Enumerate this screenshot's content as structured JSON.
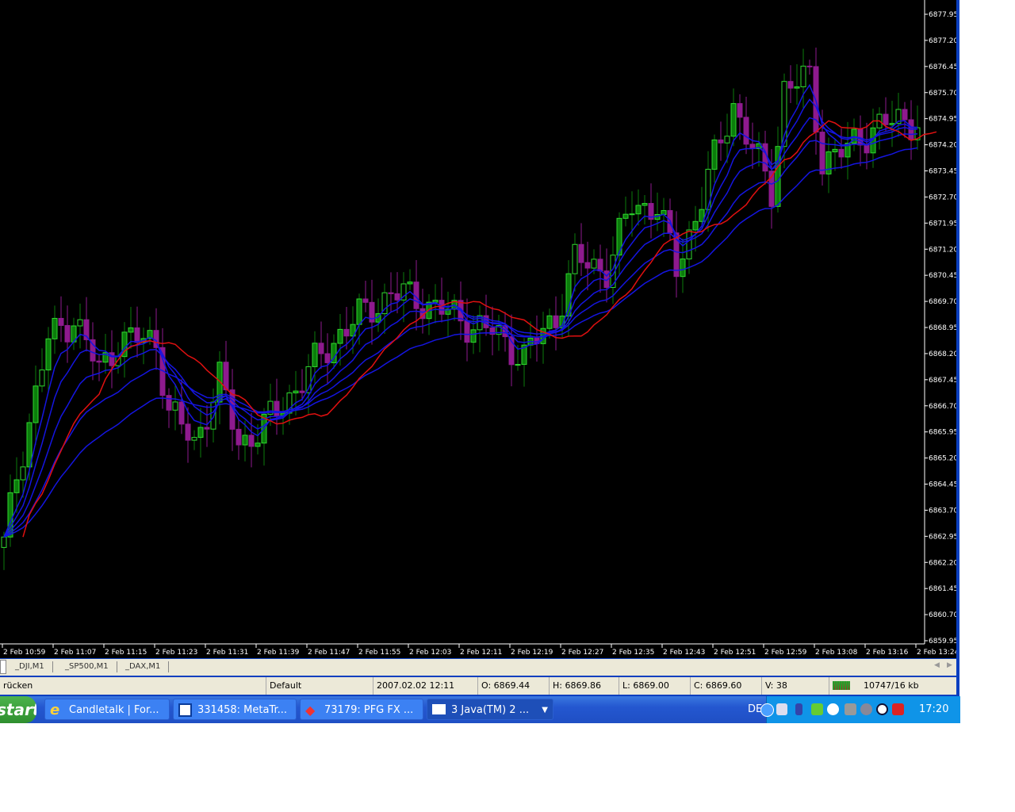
{
  "chart_data": {
    "type": "candlestick",
    "symbol": "_DAX,M1",
    "price_ticks": [
      "6877.95",
      "6877.20",
      "6876.45",
      "6875.70",
      "6874.95",
      "6874.20",
      "6873.45",
      "6872.70",
      "6871.95",
      "6871.20",
      "6870.45",
      "6869.70",
      "6868.95",
      "6868.20",
      "6867.45",
      "6866.70",
      "6865.95",
      "6865.20",
      "6864.45",
      "6863.70",
      "6862.95",
      "6862.20",
      "6861.45",
      "6860.70",
      "6859.95"
    ],
    "ylim": [
      6859.95,
      6877.95
    ],
    "time_ticks": [
      "2 Feb 10:59",
      "2 Feb 11:07",
      "2 Feb 11:15",
      "2 Feb 11:23",
      "2 Feb 11:31",
      "2 Feb 11:39",
      "2 Feb 11:47",
      "2 Feb 11:55",
      "2 Feb 12:03",
      "2 Feb 12:11",
      "2 Feb 12:19",
      "2 Feb 12:27",
      "2 Feb 12:35",
      "2 Feb 12:43",
      "2 Feb 12:51",
      "2 Feb 12:59",
      "2 Feb 13:08",
      "2 Feb 13:16",
      "2 Feb 13:24"
    ],
    "bar_count": 145,
    "price_path": [
      [
        0,
        6862.68
      ],
      [
        2,
        6864.72
      ],
      [
        7,
        6868.59
      ],
      [
        11,
        6869.27
      ],
      [
        15,
        6867.68
      ],
      [
        18,
        6868.59
      ],
      [
        24,
        6868.59
      ],
      [
        26,
        6866.54
      ],
      [
        30,
        6865.63
      ],
      [
        34,
        6867.45
      ],
      [
        37,
        6865.63
      ],
      [
        41,
        6866.09
      ],
      [
        46,
        6867.22
      ],
      [
        53,
        6868.81
      ],
      [
        61,
        6869.95
      ],
      [
        66,
        6869.72
      ],
      [
        71,
        6869.27
      ],
      [
        77,
        6868.81
      ],
      [
        82,
        6868.13
      ],
      [
        87,
        6869.27
      ],
      [
        90,
        6870.86
      ],
      [
        95,
        6870.63
      ],
      [
        99,
        6872.45
      ],
      [
        103,
        6872.45
      ],
      [
        106,
        6870.63
      ],
      [
        110,
        6872.68
      ],
      [
        115,
        6875.4
      ],
      [
        118,
        6874.04
      ],
      [
        121,
        6872.9
      ],
      [
        123,
        6875.86
      ],
      [
        127,
        6876.09
      ],
      [
        129,
        6873.81
      ],
      [
        133,
        6874.04
      ],
      [
        137,
        6874.72
      ],
      [
        144,
        6874.95
      ]
    ],
    "ma_periods": [
      5,
      8,
      13,
      21,
      34
    ],
    "colors": {
      "up": "#0b7d0b",
      "down": "#8e1a8e",
      "ma": "#1515e0",
      "ma_red": "#e01010",
      "bg": "#000000"
    }
  },
  "tabs": [
    "_DJI,M1",
    "_SP500,M1",
    "_DAX,M1"
  ],
  "status": {
    "hint": "rücken",
    "profile": "Default",
    "datetime": "2007.02.02 12:11",
    "open": "O: 6869.44",
    "high": "H: 6869.86",
    "low": "L: 6869.00",
    "close": "C: 6869.60",
    "volume": "V: 38",
    "traffic": "10747/16 kb"
  },
  "taskbar": {
    "start": "start",
    "items": [
      "Candletalk | For...",
      "331458: MetaTr...",
      "73179: PFG FX ...",
      "3 Java(TM) 2 ..."
    ],
    "lang": "DE",
    "clock": "17:20"
  }
}
